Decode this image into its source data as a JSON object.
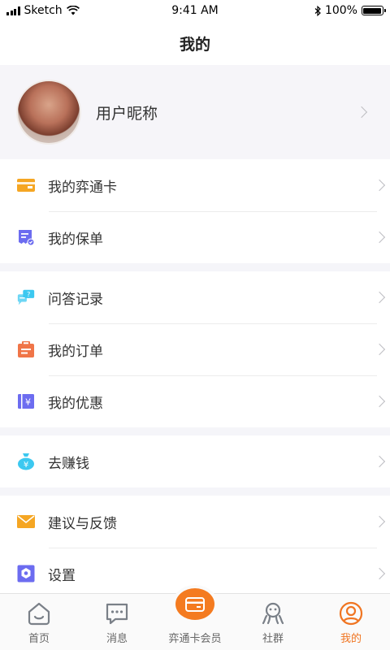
{
  "status_bar": {
    "carrier": "Sketch",
    "time": "9:41 AM",
    "battery": "100%"
  },
  "nav": {
    "title": "我的"
  },
  "profile": {
    "nickname": "用户昵称"
  },
  "groups": [
    {
      "items": [
        {
          "label": "我的弈通卡",
          "icon": "card-icon",
          "color": "#f5a623"
        },
        {
          "label": "我的保单",
          "icon": "policy-icon",
          "color": "#6c6cf0"
        }
      ]
    },
    {
      "items": [
        {
          "label": "问答记录",
          "icon": "qa-record-icon",
          "color": "#3cc8f0"
        },
        {
          "label": "我的订单",
          "icon": "order-icon",
          "color": "#f07548"
        },
        {
          "label": "我的优惠",
          "icon": "coupon-icon",
          "color": "#6c6cf0"
        }
      ]
    },
    {
      "items": [
        {
          "label": "去赚钱",
          "icon": "money-bag-icon",
          "color": "#3cc8f0"
        }
      ]
    },
    {
      "items": [
        {
          "label": "建议与反馈",
          "icon": "mail-icon",
          "color": "#f5a623"
        },
        {
          "label": "设置",
          "icon": "settings-icon",
          "color": "#6c6cf0"
        }
      ]
    }
  ],
  "tab_bar": {
    "accent": "#f07522",
    "tabs": [
      {
        "label": "首页",
        "icon": "home-icon",
        "active": false
      },
      {
        "label": "消息",
        "icon": "message-icon",
        "active": false
      },
      {
        "label": "弈通卡会员",
        "icon": "member-card-icon",
        "active": false
      },
      {
        "label": "社群",
        "icon": "community-icon",
        "active": false
      },
      {
        "label": "我的",
        "icon": "profile-icon",
        "active": true
      }
    ]
  }
}
